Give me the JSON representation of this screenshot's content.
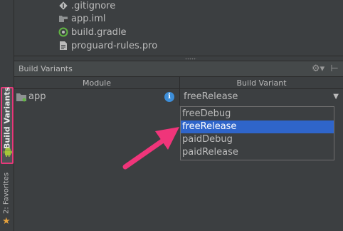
{
  "project_tree": [
    {
      "name": ".gitignore",
      "icon": "git-ignore-icon"
    },
    {
      "name": "app.iml",
      "icon": "module-file-icon"
    },
    {
      "name": "build.gradle",
      "icon": "gradle-icon"
    },
    {
      "name": "proguard-rules.pro",
      "icon": "text-file-icon"
    }
  ],
  "panel": {
    "title": "Build Variants"
  },
  "table": {
    "headers": [
      "Module",
      "Build Variant"
    ],
    "row": {
      "module": "app",
      "variant": "freeRelease"
    }
  },
  "dropdown": {
    "options": [
      "freeDebug",
      "freeRelease",
      "paidDebug",
      "paidRelease"
    ],
    "selected_index": 1
  },
  "tool_strip": {
    "build_variants": "Build Variants",
    "favorites": "2: Favorites"
  },
  "colors": {
    "highlight": "#e6397a",
    "selection": "#2f65ca",
    "info": "#3d8ed9"
  }
}
